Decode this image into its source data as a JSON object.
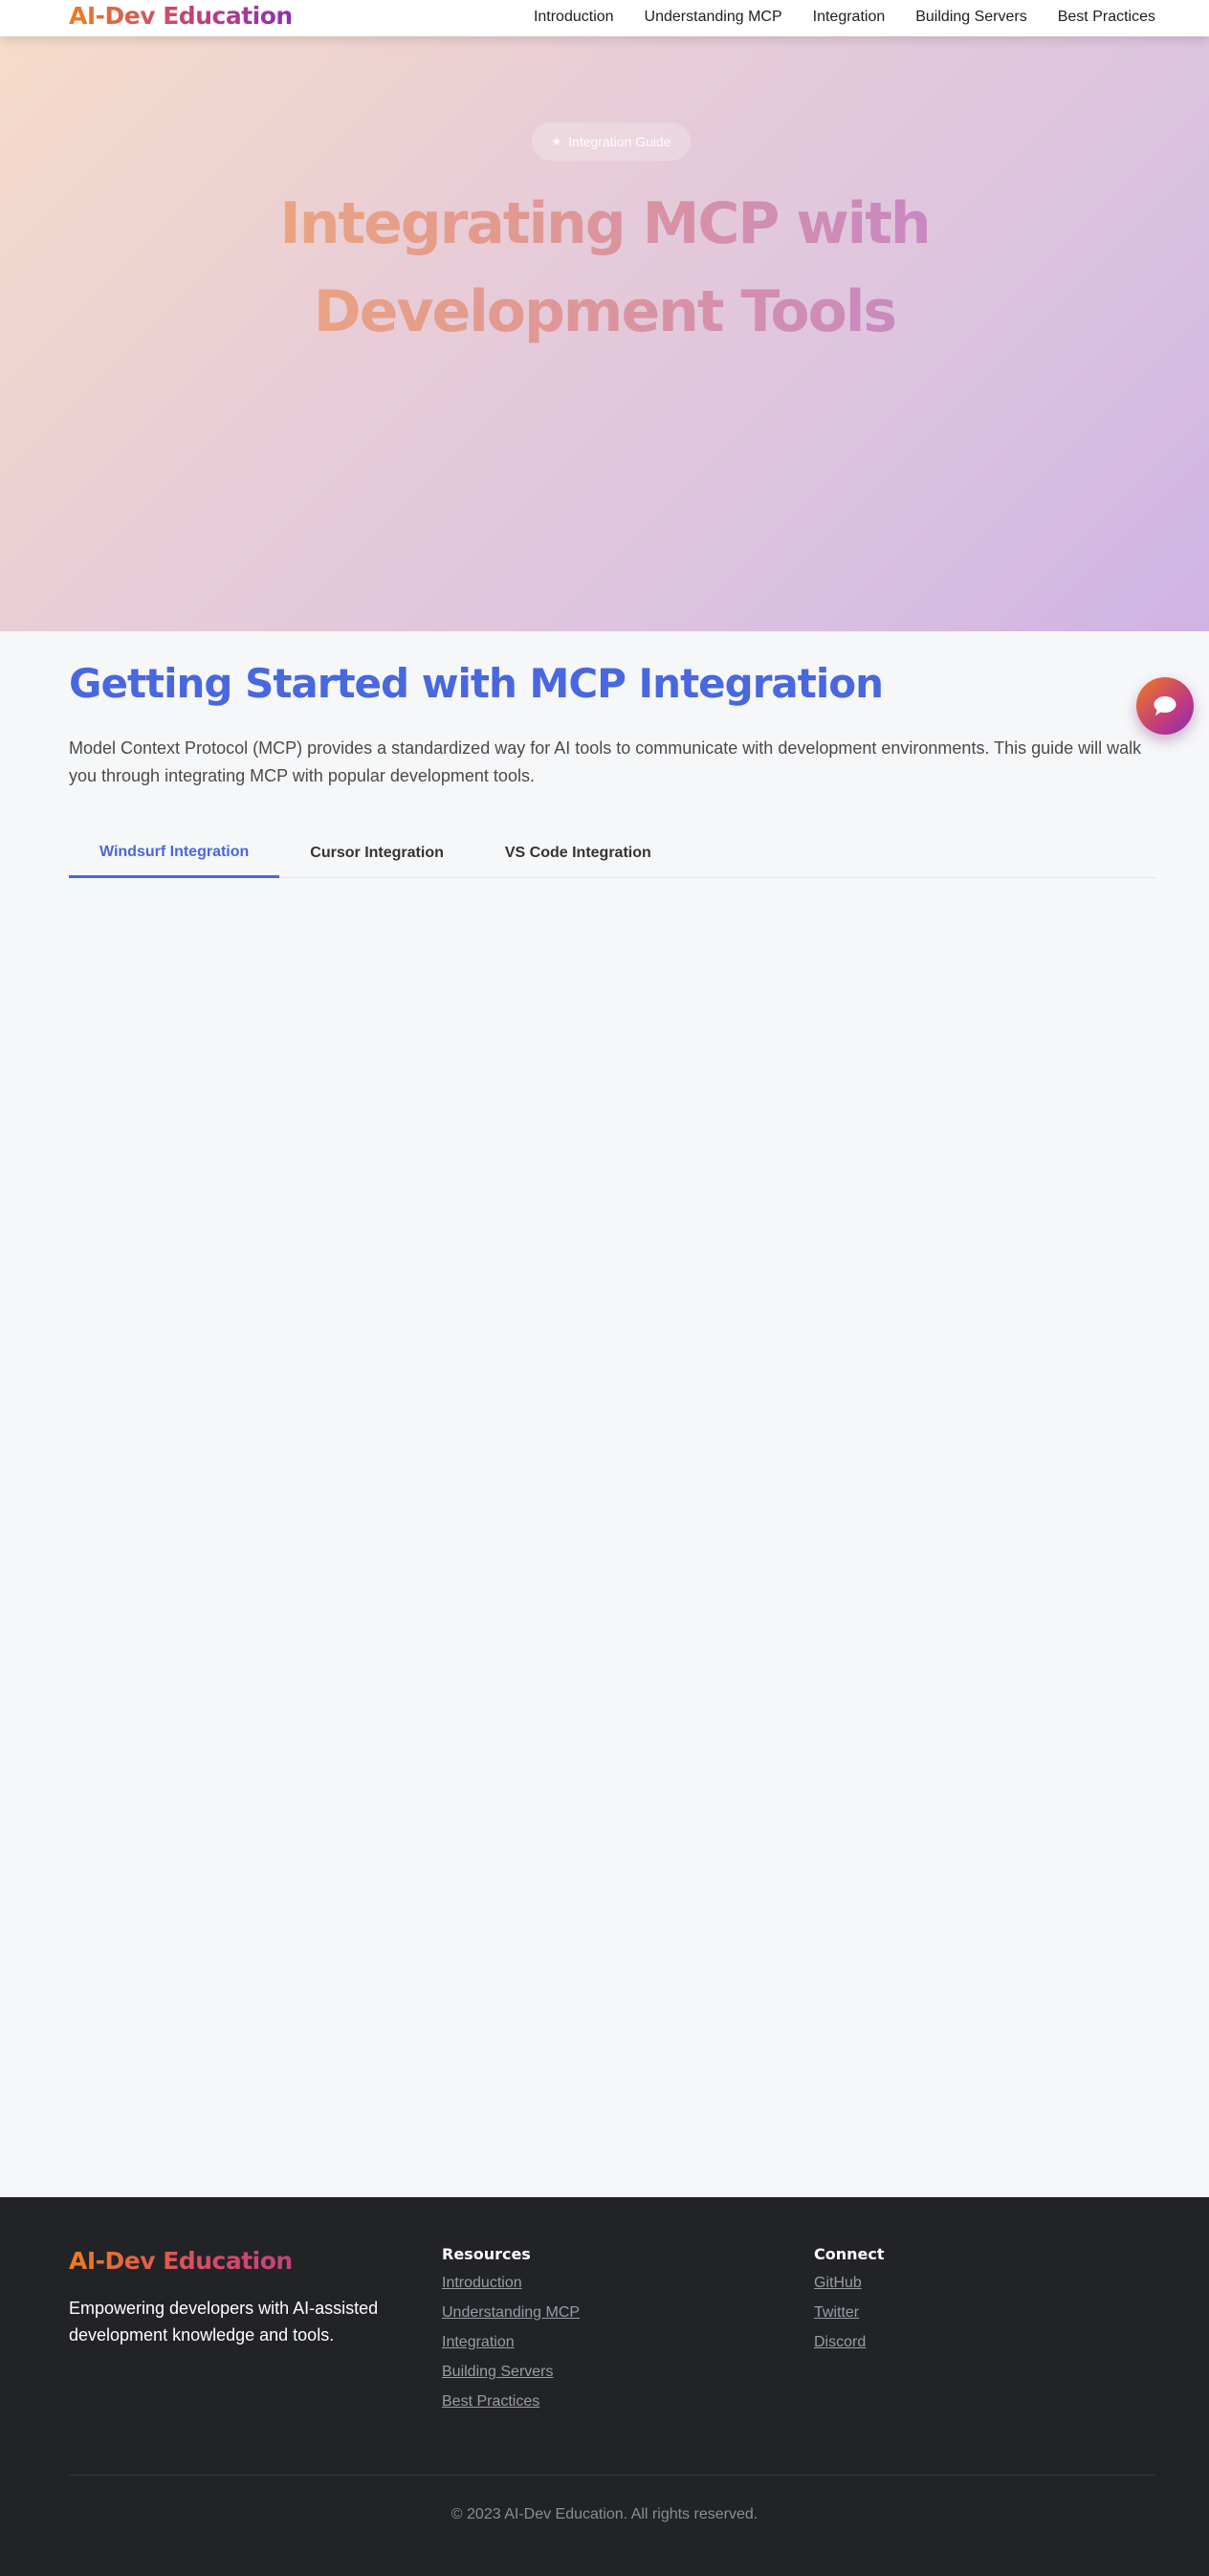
{
  "nav": {
    "logo": "AI-Dev Education",
    "links": [
      "Introduction",
      "Understanding MCP",
      "Integration",
      "Building Servers",
      "Best Practices"
    ]
  },
  "hero": {
    "badge_icon": "star-icon",
    "badge": "Integration Guide",
    "title_line1": "Integrating MCP with",
    "title_line2": "Development Tools"
  },
  "main": {
    "title": "Getting Started with MCP Integration",
    "description": "Model Context Protocol (MCP) provides a standardized way for AI tools to communicate with development environments. This guide will walk you through integrating MCP with popular development tools.",
    "tabs": [
      {
        "label": "Windsurf Integration",
        "active": true
      },
      {
        "label": "Cursor Integration",
        "active": false
      },
      {
        "label": "VS Code Integration",
        "active": false
      }
    ]
  },
  "fab": {
    "icon": "chat-bubble-icon"
  },
  "footer": {
    "logo": "AI-Dev Education",
    "tagline": "Empowering developers with AI-assisted development knowledge and tools.",
    "resources_title": "Resources",
    "resources": [
      "Introduction",
      "Understanding MCP",
      "Integration",
      "Building Servers",
      "Best Practices"
    ],
    "connect_title": "Connect",
    "connect": [
      "GitHub",
      "Twitter",
      "Discord"
    ],
    "copyright": "© 2023 AI-Dev Education. All rights reserved."
  },
  "colors": {
    "accent": "#4867e0",
    "brand_orange": "#f07c1e",
    "brand_purple": "#8b2fb0",
    "footer_bg": "#222327"
  }
}
